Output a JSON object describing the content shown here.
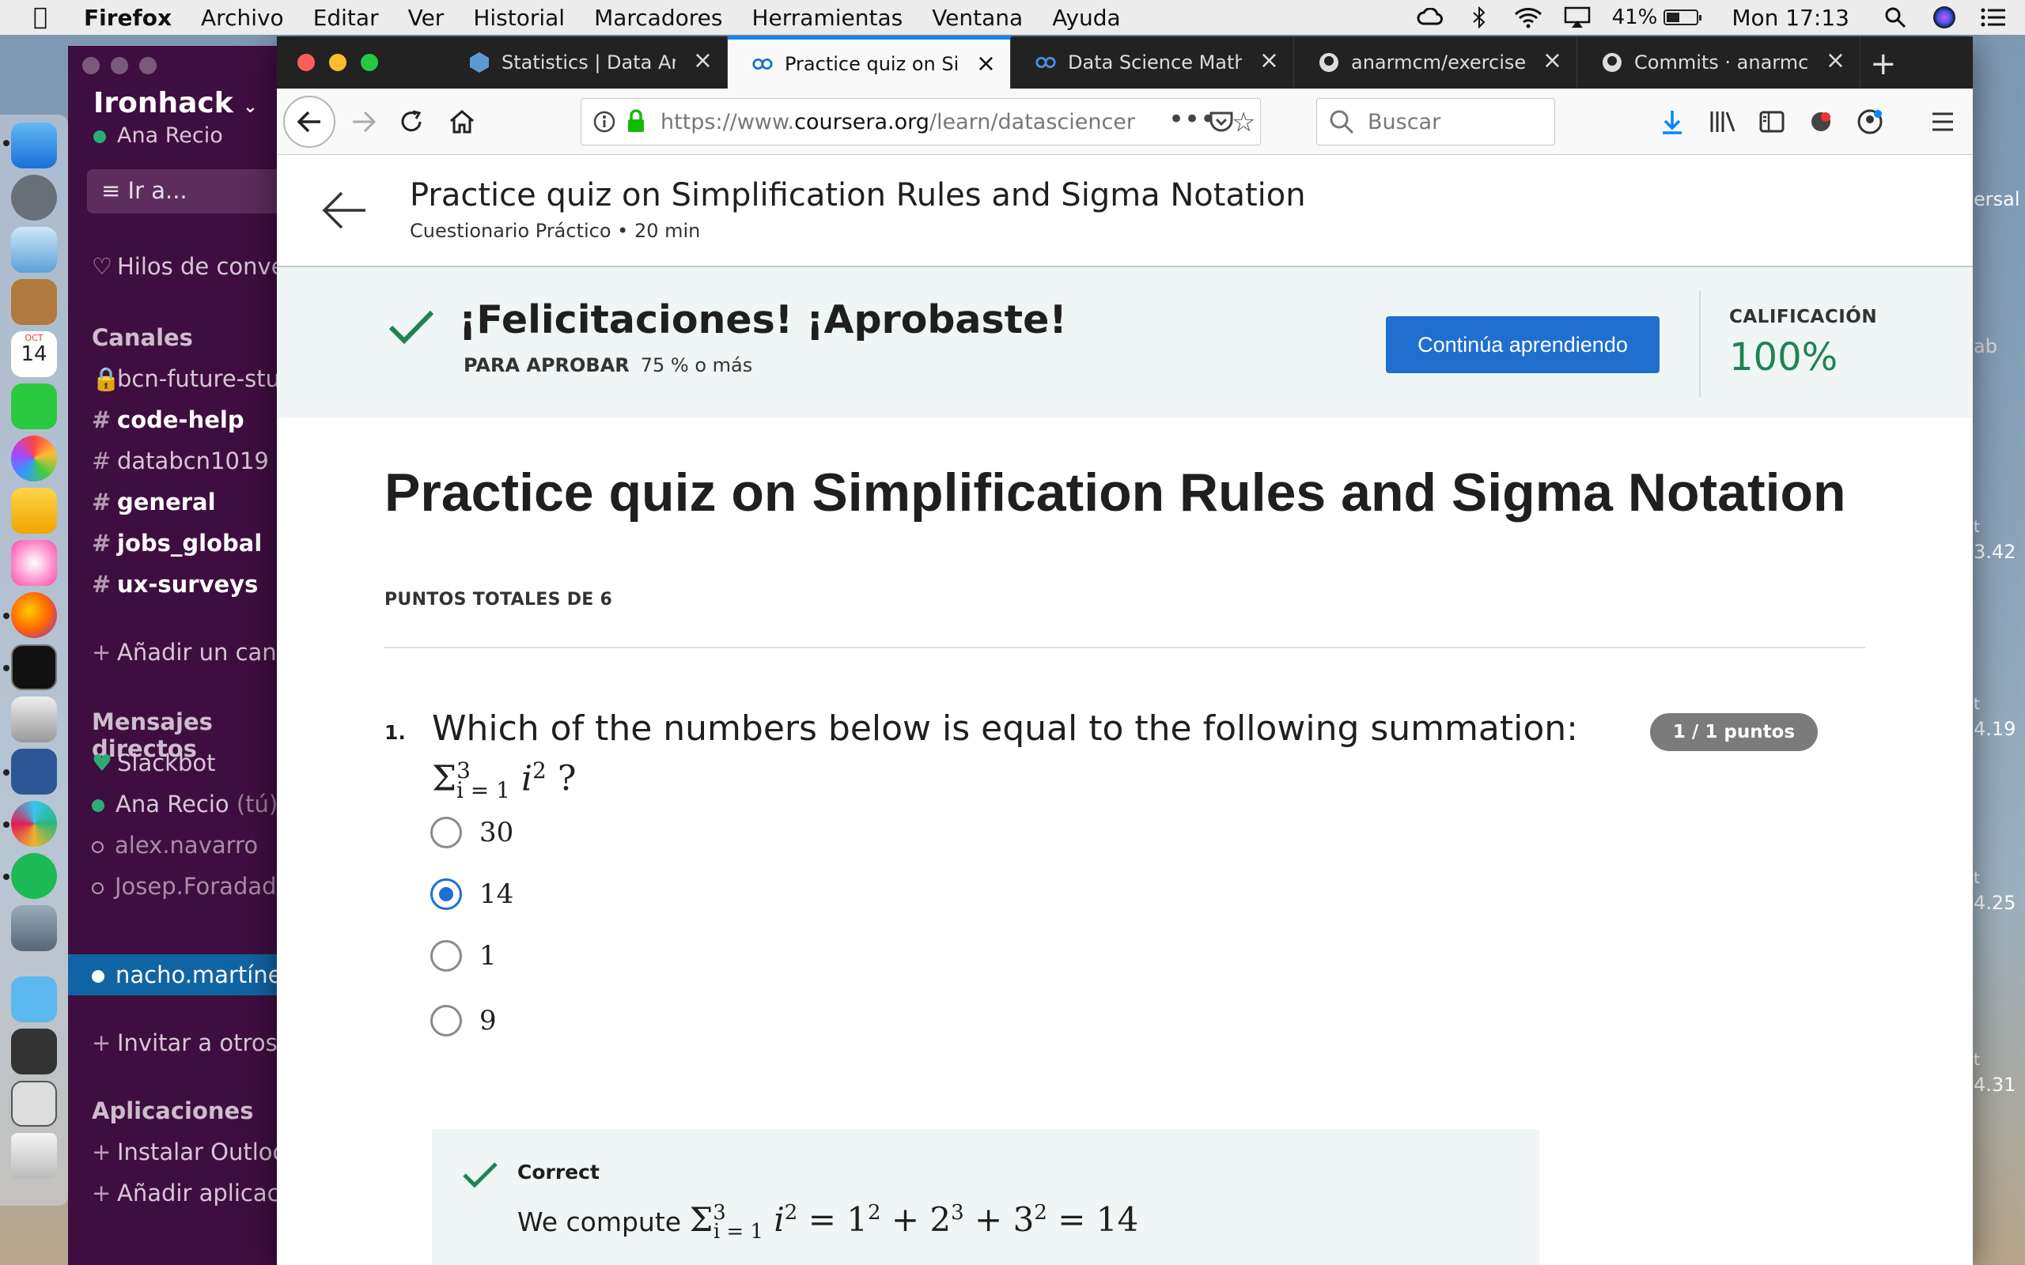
{
  "menubar": {
    "app": "Firefox",
    "items": [
      "Archivo",
      "Editar",
      "Ver",
      "Historial",
      "Marcadores",
      "Herramientas",
      "Ventana",
      "Ayuda"
    ],
    "battery": "41%",
    "clock": "Mon 17:13"
  },
  "dock": {
    "calendar_month": "OCT",
    "calendar_day": "14"
  },
  "slack": {
    "workspace": "Ironhack",
    "user": "Ana Recio",
    "jump_to": "Ir a...",
    "threads": "Hilos de conver",
    "channels_header": "Canales",
    "channels": [
      {
        "name": "bcn-future-stud",
        "bold": false,
        "private": true
      },
      {
        "name": "code-help",
        "bold": true,
        "private": false
      },
      {
        "name": "databcn1019",
        "bold": false,
        "private": false
      },
      {
        "name": "general",
        "bold": true,
        "private": false
      },
      {
        "name": "jobs_global",
        "bold": true,
        "private": false
      },
      {
        "name": "ux-surveys",
        "bold": true,
        "private": false
      }
    ],
    "add_channel": "Añadir un canal",
    "dm_header": "Mensajes directos",
    "dms": [
      {
        "name": "Slackbot",
        "status": "heart"
      },
      {
        "name": "Ana Recio",
        "suffix": "(tú)",
        "status": "online"
      },
      {
        "name": "alex.navarro",
        "status": "away"
      },
      {
        "name": "Josep.Foradada",
        "status": "away"
      },
      {
        "name": "nacho.martínez",
        "status": "selected"
      }
    ],
    "invite": "Invitar a otros",
    "apps_header": "Aplicaciones",
    "apps": [
      "Instalar Outlook",
      "Añadir aplicación"
    ]
  },
  "bg_window": {
    "fragments": [
      "ersal",
      "ab",
      "t",
      "3.42",
      "t",
      "4.19",
      "t",
      "4.25",
      "t",
      "4.31"
    ]
  },
  "browser": {
    "tabs": [
      {
        "title": "Statistics | Data Analyt",
        "active": false,
        "icon": "stats-favicon"
      },
      {
        "title": "Practice quiz on Simpli",
        "active": true,
        "icon": "coursera-favicon"
      },
      {
        "title": "Data Science Math Ski",
        "active": false,
        "icon": "coursera-favicon"
      },
      {
        "title": "anarmcm/exercises-pr",
        "active": false,
        "icon": "github-favicon"
      },
      {
        "title": "Commits · anarmcm/e",
        "active": false,
        "icon": "github-favicon"
      }
    ],
    "url_prefix": "https://www.",
    "url_domain": "coursera.org",
    "url_path": "/learn/datasciencem",
    "search_placeholder": "Buscar"
  },
  "page": {
    "header_title": "Practice quiz on Simplification Rules and Sigma Notation",
    "header_subtitle": "Cuestionario Práctico • 20 min",
    "banner_title": "¡Felicitaciones! ¡Aprobaste!",
    "pass_label": "PARA APROBAR",
    "pass_value": "75 % o más",
    "continue_button": "Continúa aprendiendo",
    "grade_label": "CALIFICACIÓN",
    "grade_value": "100%",
    "quiz_title": "Practice quiz on Simplification Rules and Sigma Notation",
    "points_total": "PUNTOS TOTALES DE 6",
    "question": {
      "number": "1.",
      "text": "Which of the numbers below is equal to the following summation:",
      "score": "1 / 1 puntos",
      "options": [
        {
          "label": "30",
          "selected": false
        },
        {
          "label": "14",
          "selected": true
        },
        {
          "label": "1",
          "selected": false
        },
        {
          "label": "9",
          "selected": false
        }
      ],
      "feedback_label": "Correct",
      "feedback_text": "We compute"
    }
  },
  "colors": {
    "slack_bg": "#3f0e40",
    "coursera_blue": "#1f6fd0",
    "success_green": "#1f8354",
    "banner_bg": "#f0f6f5"
  }
}
